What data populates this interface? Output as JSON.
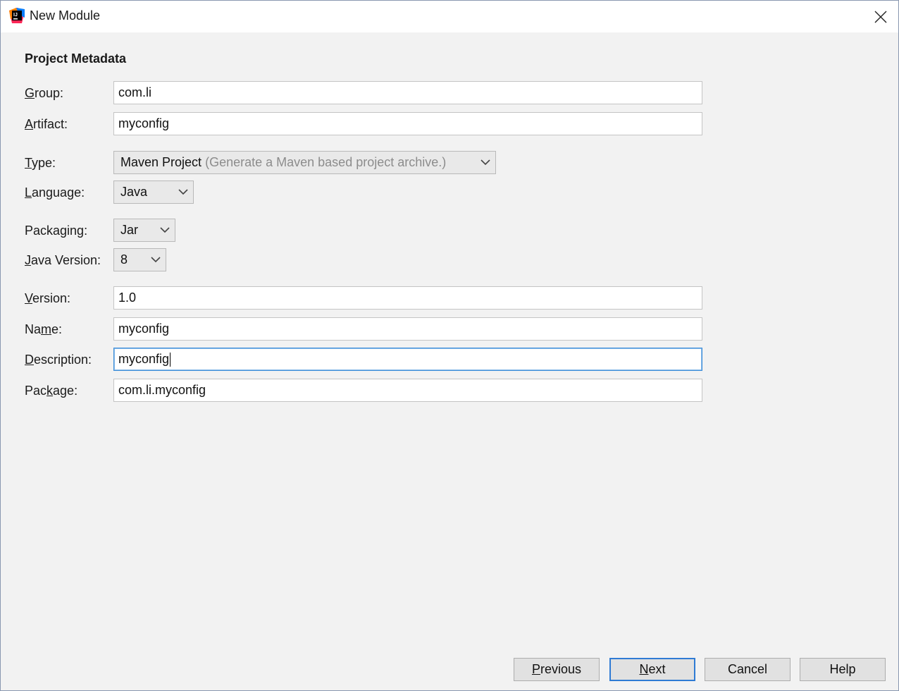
{
  "window": {
    "title": "New Module",
    "icon": "intellij-idea-icon"
  },
  "section": {
    "title": "Project Metadata"
  },
  "fields": {
    "group": {
      "mnemonic": "G",
      "rest": "roup:",
      "value": "com.li"
    },
    "artifact": {
      "mnemonic": "A",
      "rest": "rtifact:",
      "value": "myconfig"
    },
    "type": {
      "mnemonic": "T",
      "rest": "ype:",
      "value": "Maven Project",
      "hint": "(Generate a Maven based project archive.)"
    },
    "language": {
      "mnemonic": "L",
      "rest": "anguage:",
      "value": "Java"
    },
    "packaging": {
      "pre": "Packa",
      "mnemonic": "g",
      "rest": "ing:",
      "value": "Jar"
    },
    "java_version": {
      "mnemonic": "J",
      "rest": "ava Version:",
      "value": "8"
    },
    "version": {
      "mnemonic": "V",
      "rest": "ersion:",
      "value": "1.0"
    },
    "name": {
      "pre": "Na",
      "mnemonic": "m",
      "rest": "e:",
      "value": "myconfig"
    },
    "description": {
      "mnemonic": "D",
      "rest": "escription:",
      "value": "myconfig"
    },
    "package": {
      "pre": "Pac",
      "mnemonic": "k",
      "rest": "age:",
      "value": "com.li.myconfig"
    }
  },
  "buttons": {
    "previous": {
      "mnemonic": "P",
      "rest": "revious"
    },
    "next": {
      "mnemonic": "N",
      "rest": "ext"
    },
    "cancel": {
      "label": "Cancel"
    },
    "help": {
      "label": "Help"
    }
  },
  "colors": {
    "focus_border": "#3d8ed9",
    "default_button_border": "#2f7bd4",
    "dialog_background": "#f2f2f2"
  }
}
